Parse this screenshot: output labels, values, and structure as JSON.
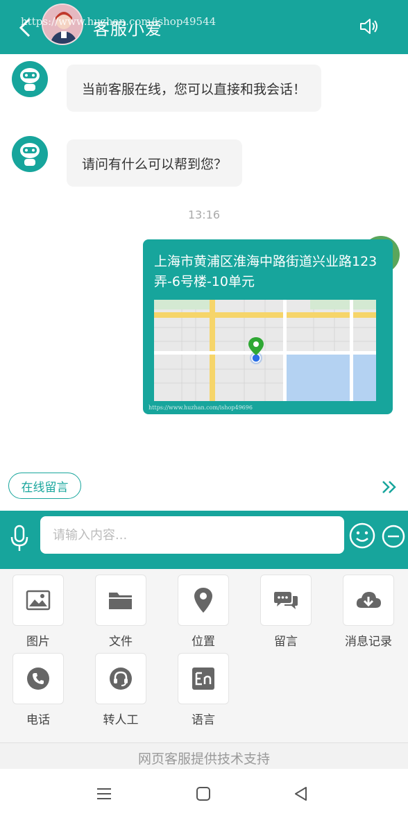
{
  "header": {
    "agent_name": "客服小爱",
    "watermark": "https://www.huzhan.com/ishop49544",
    "back_icon": "chevron-left-icon",
    "speaker_icon": "speaker-icon"
  },
  "colors": {
    "primary": "#17a59c",
    "bubble_bg": "#f4f4f4",
    "tool_icon": "#666666"
  },
  "chat": {
    "messages": [
      {
        "from": "agent",
        "text": "当前客服在线，您可以直接和我会话！"
      },
      {
        "from": "agent",
        "text": "请问有什么可以帮到您？"
      }
    ],
    "timestamp": "13:16",
    "location_message": {
      "address": "上海市黄浦区淮海中路街道兴业路123弄-6号楼-10单元",
      "watermark": "https://www.huzhan.com/ishop49696"
    },
    "leave_message_button": "在线留言",
    "more_icon": "double-chevron-right-icon"
  },
  "input": {
    "placeholder": "请输入内容...",
    "value": "",
    "mic_icon": "microphone-icon",
    "emoji_icon": "smiley-icon",
    "collapse_icon": "minus-circle-icon"
  },
  "tools": [
    {
      "label": "图片",
      "icon": "image-icon"
    },
    {
      "label": "文件",
      "icon": "folder-icon"
    },
    {
      "label": "位置",
      "icon": "location-pin-icon"
    },
    {
      "label": "留言",
      "icon": "chat-bubbles-icon"
    },
    {
      "label": "消息记录",
      "icon": "cloud-download-icon"
    },
    {
      "label": "电话",
      "icon": "phone-icon"
    },
    {
      "label": "转人工",
      "icon": "headset-icon"
    },
    {
      "label": "语言",
      "icon": "language-en-icon"
    }
  ],
  "footer": {
    "support_text": "网页客服提供技术支持"
  },
  "system_nav": {
    "menu_icon": "menu-icon",
    "home_icon": "home-square-icon",
    "back_icon": "back-triangle-icon"
  }
}
